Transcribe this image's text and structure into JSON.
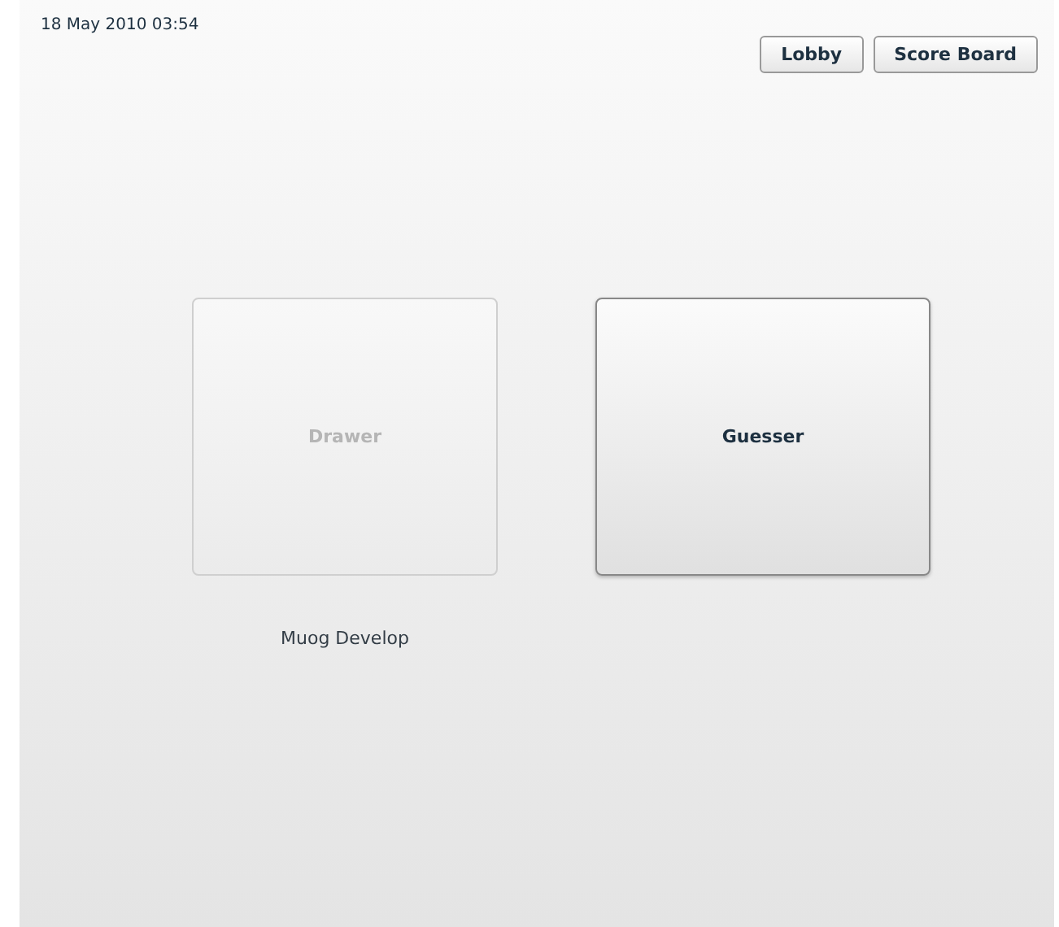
{
  "timestamp": "18 May 2010 03:54",
  "nav_buttons": [
    "Lobby",
    "Score Board"
  ],
  "roles": [
    {
      "label": "Drawer",
      "disabled": true,
      "player": "Muog Develop"
    },
    {
      "label": "Guesser",
      "disabled": false
    }
  ]
}
